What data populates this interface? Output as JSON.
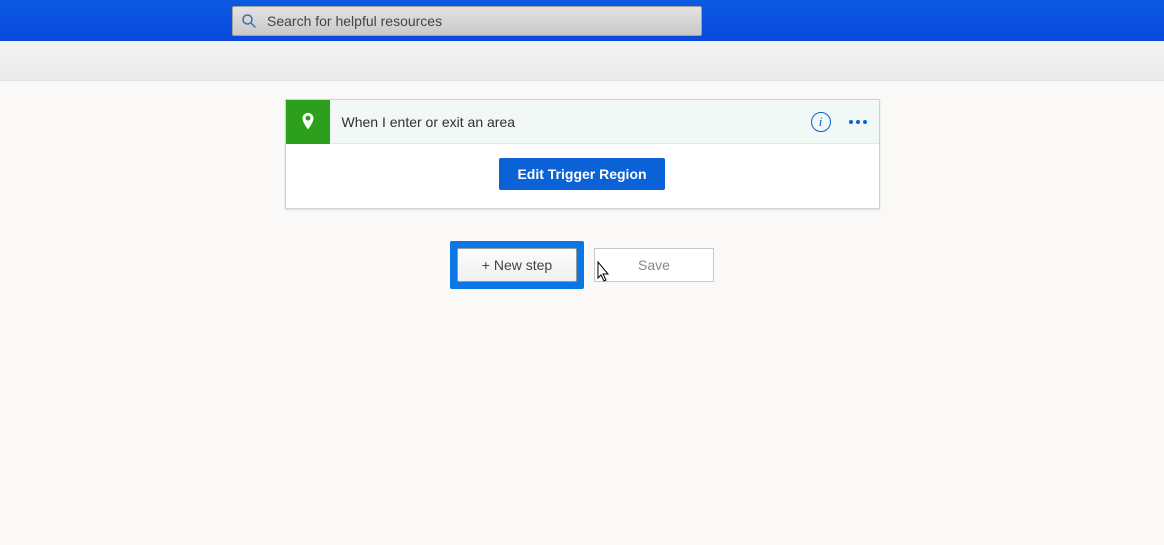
{
  "header": {
    "search_placeholder": "Search for helpful resources"
  },
  "trigger": {
    "title": "When I enter or exit an area",
    "body_button": "Edit Trigger Region"
  },
  "actions": {
    "new_step": "+ New step",
    "save": "Save"
  }
}
